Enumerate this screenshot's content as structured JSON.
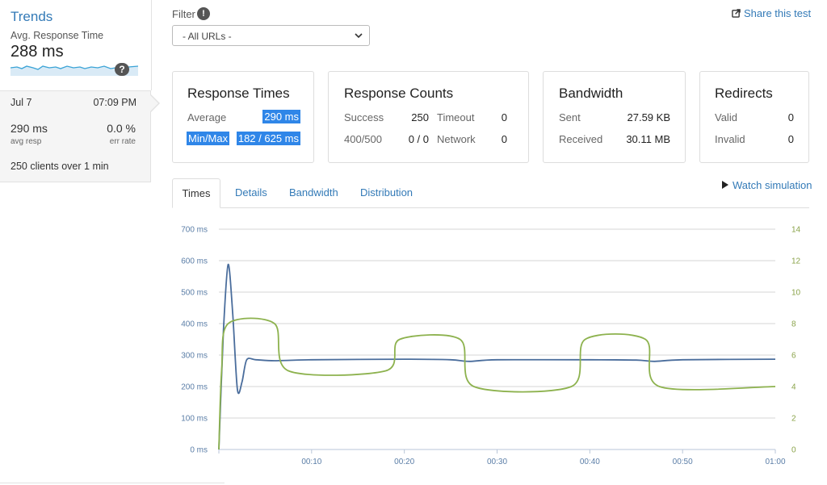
{
  "trends": {
    "title": "Trends",
    "subtitle": "Avg. Response Time",
    "value": "288 ms",
    "help": "?"
  },
  "summary": {
    "date": "Jul 7",
    "time": "07:09 PM",
    "avg_resp_value": "290 ms",
    "avg_resp_label": "avg resp",
    "err_rate_value": "0.0 %",
    "err_rate_label": "err rate",
    "clients_text": "250 clients over 1 min"
  },
  "filter": {
    "label": "Filter",
    "help": "!",
    "selected": "- All URLs -"
  },
  "share": {
    "label": "Share this test"
  },
  "cards": {
    "response_times": {
      "title": "Response Times",
      "average_label": "Average",
      "average_value": "290 ms",
      "minmax_label": "Min/Max",
      "minmax_value": "182 / 625 ms"
    },
    "response_counts": {
      "title": "Response Counts",
      "success_label": "Success",
      "success_value": "250",
      "timeout_label": "Timeout",
      "timeout_value": "0",
      "errors_label": "400/500",
      "errors_value": "0 / 0",
      "network_label": "Network",
      "network_value": "0"
    },
    "bandwidth": {
      "title": "Bandwidth",
      "sent_label": "Sent",
      "sent_value": "27.59 KB",
      "received_label": "Received",
      "received_value": "30.11 MB"
    },
    "redirects": {
      "title": "Redirects",
      "valid_label": "Valid",
      "valid_value": "0",
      "invalid_label": "Invalid",
      "invalid_value": "0"
    }
  },
  "tabs": [
    {
      "label": "Times",
      "active": true
    },
    {
      "label": "Details",
      "active": false
    },
    {
      "label": "Bandwidth",
      "active": false
    },
    {
      "label": "Distribution",
      "active": false
    }
  ],
  "watch": {
    "label": "Watch simulation"
  },
  "colors": {
    "response_line": "#4a6d9c",
    "clients_line": "#8db24e",
    "link": "#337ab7",
    "highlight": "#2f86e8"
  },
  "chart_data": {
    "type": "line",
    "x_ticks": [
      "00:10",
      "00:20",
      "00:30",
      "00:40",
      "00:50",
      "01:00"
    ],
    "y_left_ticks": [
      "0 ms",
      "100 ms",
      "200 ms",
      "300 ms",
      "400 ms",
      "500 ms",
      "600 ms",
      "700 ms"
    ],
    "y_right_ticks": [
      "0",
      "2",
      "4",
      "6",
      "8",
      "10",
      "12",
      "14"
    ],
    "ylim_left": [
      0,
      700
    ],
    "ylim_right": [
      0,
      14
    ],
    "xlim": [
      0,
      60
    ],
    "grid": true,
    "series": [
      {
        "axis": "left",
        "color": "#4a6d9c",
        "points": [
          [
            0,
            0
          ],
          [
            0.5,
            380
          ],
          [
            1,
            588
          ],
          [
            1.5,
            430
          ],
          [
            2,
            190
          ],
          [
            2.5,
            215
          ],
          [
            3,
            285
          ],
          [
            4,
            285
          ],
          [
            6,
            282
          ],
          [
            10,
            285
          ],
          [
            20,
            287
          ],
          [
            25,
            285
          ],
          [
            27,
            280
          ],
          [
            30,
            285
          ],
          [
            40,
            285
          ],
          [
            45,
            284
          ],
          [
            47,
            280
          ],
          [
            50,
            285
          ],
          [
            60,
            287
          ]
        ]
      },
      {
        "axis": "right",
        "color": "#8db24e",
        "points": [
          [
            0,
            0
          ],
          [
            0.3,
            5
          ],
          [
            1,
            8
          ],
          [
            6,
            8
          ],
          [
            7.5,
            5
          ],
          [
            18,
            5
          ],
          [
            19.5,
            7
          ],
          [
            26,
            7
          ],
          [
            27.5,
            4
          ],
          [
            38,
            4
          ],
          [
            39.5,
            7
          ],
          [
            46,
            7
          ],
          [
            47.5,
            4
          ],
          [
            60,
            4
          ]
        ]
      }
    ]
  }
}
